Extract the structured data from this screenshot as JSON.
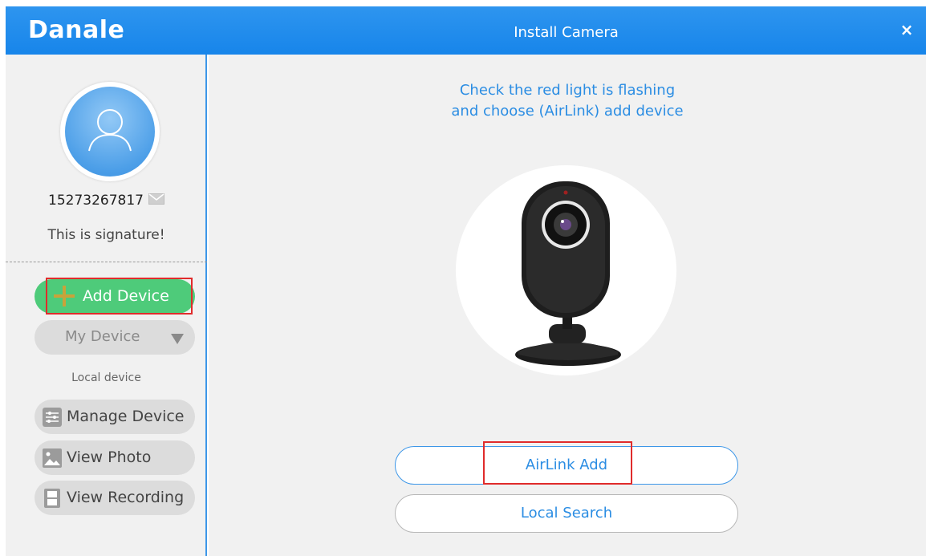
{
  "header": {
    "brand": "Danale",
    "title": "Install Camera",
    "close_glyph": "×"
  },
  "sidebar": {
    "phone": "15273267817",
    "signature": "This is signature!",
    "add_device_label": "Add Device",
    "my_device_label": "My Device",
    "local_device_label": "Local device",
    "items": [
      {
        "label": "Manage Device",
        "icon": "sliders-icon"
      },
      {
        "label": "View Photo",
        "icon": "photo-icon"
      },
      {
        "label": "View Recording",
        "icon": "film-icon"
      }
    ]
  },
  "main": {
    "instruction_line1": "Check the red light is flashing",
    "instruction_line2": "and choose (AirLink) add device",
    "airlink_label": "AirLink Add",
    "local_search_label": "Local Search"
  },
  "colors": {
    "accent": "#1785ea",
    "add_green": "#4ecb7a",
    "highlight_red": "#e02b2b",
    "link_blue": "#2b8de3"
  }
}
